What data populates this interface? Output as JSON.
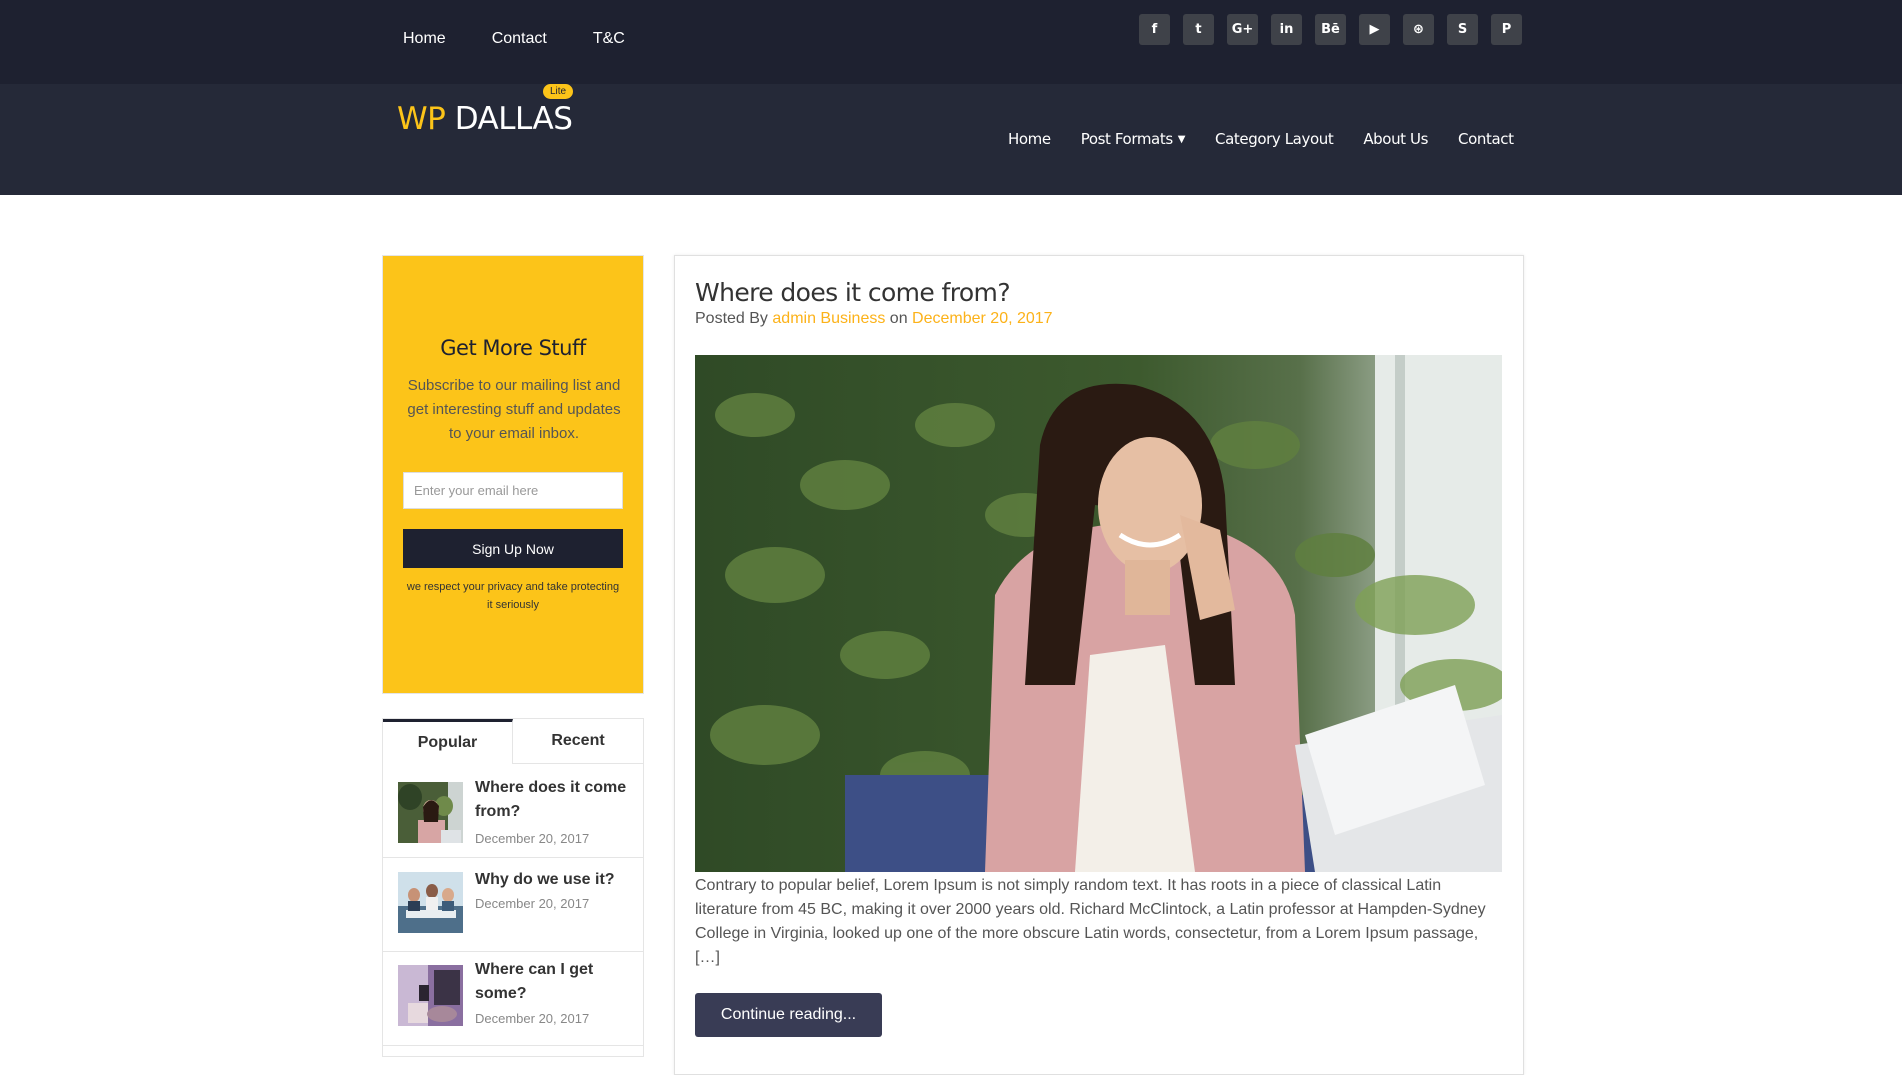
{
  "top_nav": [
    "Home",
    "Contact",
    "T&C"
  ],
  "socials": [
    {
      "icon": "facebook-icon",
      "glyph": "f"
    },
    {
      "icon": "twitter-icon",
      "glyph": "t"
    },
    {
      "icon": "google-plus-icon",
      "glyph": "G+"
    },
    {
      "icon": "linkedin-icon",
      "glyph": "in"
    },
    {
      "icon": "behance-icon",
      "glyph": "Bē"
    },
    {
      "icon": "youtube-icon",
      "glyph": "▶"
    },
    {
      "icon": "dribbble-icon",
      "glyph": "⊛"
    },
    {
      "icon": "skype-icon",
      "glyph": "S"
    },
    {
      "icon": "pinterest-icon",
      "glyph": "P"
    }
  ],
  "logo": {
    "part1": "WP",
    "part2": " DALLAS",
    "badge": "Lite"
  },
  "main_nav": {
    "home": "Home",
    "post_formats": "Post Formats",
    "category_layout": "Category Layout",
    "about": "About Us",
    "contact": "Contact"
  },
  "subscribe": {
    "title": "Get More Stuff",
    "description": "Subscribe to our mailing list and get interesting stuff and updates to your email inbox.",
    "placeholder": "Enter your email here",
    "button": "Sign Up Now",
    "note": "we respect your privacy and take protecting it seriously"
  },
  "tabs": {
    "popular": "Popular",
    "recent": "Recent"
  },
  "popular_posts": [
    {
      "title": "Where does it come from?",
      "date": "December 20, 2017"
    },
    {
      "title": "Why do we use it?",
      "date": "December 20, 2017"
    },
    {
      "title": "Where can I get some?",
      "date": "December 20, 2017"
    }
  ],
  "post": {
    "title": "Where does it come from?",
    "posted_by": "Posted By",
    "author": "admin",
    "category": "Business",
    "on": "on",
    "date": "December 20, 2017",
    "excerpt": "Contrary to popular belief, Lorem Ipsum is not simply random text. It has roots in a piece of classical Latin literature from 45 BC, making it over 2000 years old. Richard McClintock, a Latin professor at Hampden-Sydney College in Virginia, looked up one of the more obscure Latin words, consectetur, from a Lorem Ipsum passage, […]",
    "read_more": "Continue reading..."
  },
  "colors": {
    "dark": "#1e2130",
    "header": "#252938",
    "accent": "#fcc419",
    "link": "#fcb219",
    "button": "#393c55"
  }
}
